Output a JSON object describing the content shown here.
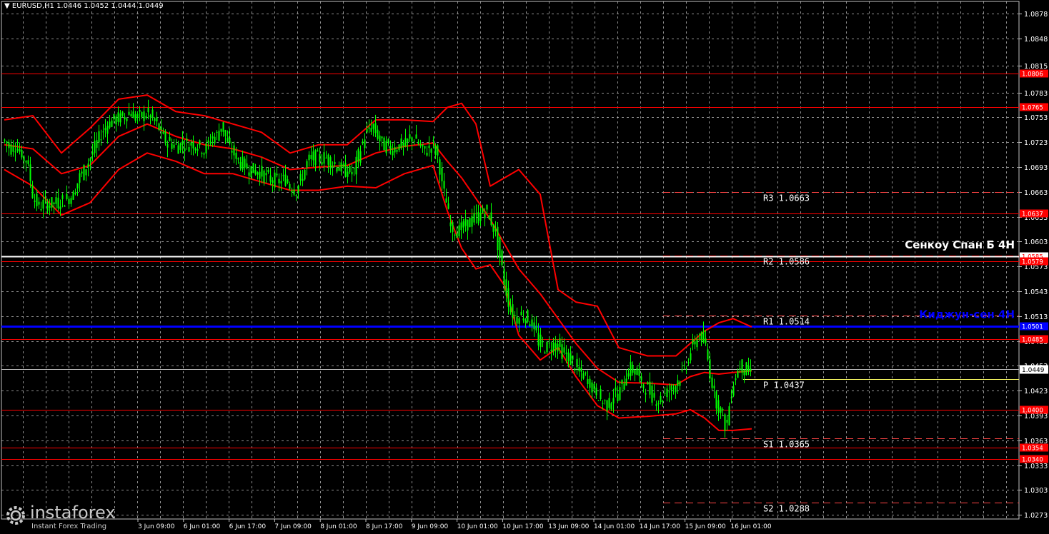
{
  "header": {
    "symbol_line": "EURUSD,H1  1.0446 1.0452 1.0444 1.0449"
  },
  "logo": {
    "brand": "instaforex",
    "tagline": "Instant Forex Trading"
  },
  "colors": {
    "background": "#000000",
    "grid": "#c0c0c0",
    "candles": "#00ff00",
    "bollinger": "#ff0000",
    "levels": "#ff0000",
    "kijun": "#0000ff",
    "senkou": "#ffffff",
    "pivot": "#ffff66",
    "pivot_sr": "#ff4444"
  },
  "chart_data": {
    "type": "candlestick",
    "symbol": "EURUSD",
    "timeframe": "H1",
    "ylim": [
      1.0268,
      1.0893
    ],
    "y_ticks": [
      "1.0878",
      "1.0848",
      "1.0815",
      "1.0783",
      "1.0753",
      "1.0723",
      "1.0693",
      "1.0663",
      "1.0633",
      "1.0603",
      "1.0573",
      "1.0543",
      "1.0513",
      "1.0483",
      "1.0453",
      "1.0423",
      "1.0393",
      "1.0363",
      "1.0333",
      "1.0303",
      "1.0273"
    ],
    "x_ticks": [
      "3 Jun 09:00",
      "6 Jun 01:00",
      "6 Jun 17:00",
      "7 Jun 09:00",
      "8 Jun 01:00",
      "8 Jun 17:00",
      "9 Jun 09:00",
      "10 Jun 01:00",
      "10 Jun 17:00",
      "13 Jun 09:00",
      "14 Jun 01:00",
      "14 Jun 17:00",
      "15 Jun 09:00",
      "16 Jun 01:00"
    ],
    "last_price": {
      "value": 1.0449,
      "label": "1.0449"
    },
    "horizontal_levels": [
      {
        "value": 1.0806,
        "label": "1.0806",
        "kind": "level"
      },
      {
        "value": 1.0765,
        "label": "1.0765",
        "kind": "level"
      },
      {
        "value": 1.0637,
        "label": "1.0637",
        "kind": "level"
      },
      {
        "value": 1.0585,
        "label": "1.0585",
        "kind": "senkou"
      },
      {
        "value": 1.0579,
        "label": "1.0579",
        "kind": "level"
      },
      {
        "value": 1.0501,
        "label": "1.0501",
        "kind": "kijun"
      },
      {
        "value": 1.0485,
        "label": "1.0485",
        "kind": "level"
      },
      {
        "value": 1.04,
        "label": "1.0400",
        "kind": "level"
      },
      {
        "value": 1.0354,
        "label": "1.0354",
        "kind": "level"
      },
      {
        "value": 1.034,
        "label": "1.0340",
        "kind": "level"
      }
    ],
    "pivots": [
      {
        "name": "R3",
        "value": 1.0663,
        "label": "R3  1.0663"
      },
      {
        "name": "R2",
        "value": 1.0586,
        "label": "R2  1.0586"
      },
      {
        "name": "R1",
        "value": 1.0514,
        "label": "R1  1.0514"
      },
      {
        "name": "P",
        "value": 1.0437,
        "label": "P  1.0437"
      },
      {
        "name": "S1",
        "value": 1.0365,
        "label": "S1  1.0365"
      },
      {
        "name": "S2",
        "value": 1.0288,
        "label": "S2  1.0288"
      }
    ],
    "annotations": [
      {
        "text": "Сенкоу Спан Б 4H",
        "value": 1.06,
        "color": "#ffffff"
      },
      {
        "text": "Киджун-сен 4H",
        "value": 1.0514,
        "color": "#0000ff"
      }
    ],
    "price_path": [
      [
        0,
        1.0725
      ],
      [
        8,
        1.0715
      ],
      [
        16,
        1.072
      ],
      [
        24,
        1.0705
      ],
      [
        32,
        1.07
      ],
      [
        40,
        1.0655
      ],
      [
        48,
        1.0645
      ],
      [
        56,
        1.065
      ],
      [
        64,
        1.0648
      ],
      [
        72,
        1.065
      ],
      [
        80,
        1.0652
      ],
      [
        88,
        1.0655
      ],
      [
        96,
        1.066
      ],
      [
        104,
        1.068
      ],
      [
        112,
        1.069
      ],
      [
        120,
        1.0705
      ],
      [
        128,
        1.072
      ],
      [
        136,
        1.0735
      ],
      [
        144,
        1.0745
      ],
      [
        152,
        1.075
      ],
      [
        160,
        1.0752
      ],
      [
        168,
        1.0755
      ],
      [
        176,
        1.076
      ],
      [
        184,
        1.0752
      ],
      [
        192,
        1.0755
      ],
      [
        200,
        1.0758
      ],
      [
        208,
        1.075
      ],
      [
        216,
        1.074
      ],
      [
        224,
        1.0725
      ],
      [
        232,
        1.0722
      ],
      [
        240,
        1.0718
      ],
      [
        248,
        1.0722
      ],
      [
        256,
        1.072
      ],
      [
        264,
        1.0722
      ],
      [
        272,
        1.0718
      ],
      [
        280,
        1.0712
      ],
      [
        288,
        1.0728
      ],
      [
        296,
        1.073
      ],
      [
        304,
        1.0745
      ],
      [
        312,
        1.072
      ],
      [
        320,
        1.071
      ],
      [
        328,
        1.07
      ],
      [
        336,
        1.0695
      ],
      [
        344,
        1.069
      ],
      [
        352,
        1.0688
      ],
      [
        360,
        1.0685
      ],
      [
        368,
        1.068
      ],
      [
        376,
        1.0678
      ],
      [
        384,
        1.0675
      ],
      [
        392,
        1.068
      ],
      [
        400,
        1.067
      ],
      [
        408,
        1.0665
      ],
      [
        416,
        1.068
      ],
      [
        424,
        1.07
      ],
      [
        432,
        1.0705
      ],
      [
        440,
        1.0703
      ],
      [
        448,
        1.0705
      ],
      [
        456,
        1.07
      ],
      [
        464,
        1.0695
      ],
      [
        472,
        1.069
      ],
      [
        480,
        1.0688
      ],
      [
        488,
        1.0685
      ],
      [
        496,
        1.071
      ],
      [
        504,
        1.073
      ],
      [
        512,
        1.0742
      ],
      [
        520,
        1.0735
      ],
      [
        528,
        1.072
      ],
      [
        536,
        1.0718
      ],
      [
        544,
        1.0715
      ],
      [
        552,
        1.072
      ],
      [
        560,
        1.0718
      ],
      [
        568,
        1.073
      ],
      [
        576,
        1.0725
      ],
      [
        584,
        1.0712
      ],
      [
        592,
        1.0715
      ],
      [
        600,
        1.072
      ],
      [
        608,
        1.07
      ],
      [
        612,
        1.067
      ],
      [
        618,
        1.065
      ],
      [
        624,
        1.062
      ],
      [
        632,
        1.0615
      ],
      [
        640,
        1.062
      ],
      [
        648,
        1.0625
      ],
      [
        656,
        1.063
      ],
      [
        664,
        1.0635
      ],
      [
        672,
        1.064
      ],
      [
        680,
        1.063
      ],
      [
        688,
        1.061
      ],
      [
        694,
        1.058
      ],
      [
        700,
        1.055
      ],
      [
        708,
        1.052
      ],
      [
        716,
        1.051
      ],
      [
        724,
        1.0515
      ],
      [
        732,
        1.051
      ],
      [
        740,
        1.05
      ],
      [
        748,
        1.048
      ],
      [
        756,
        1.0475
      ],
      [
        764,
        1.0478
      ],
      [
        772,
        1.048
      ],
      [
        780,
        1.047
      ],
      [
        788,
        1.0465
      ],
      [
        796,
        1.0455
      ],
      [
        804,
        1.0445
      ],
      [
        812,
        1.044
      ],
      [
        820,
        1.043
      ],
      [
        828,
        1.042
      ],
      [
        836,
        1.041
      ],
      [
        844,
        1.0405
      ],
      [
        852,
        1.0418
      ],
      [
        860,
        1.042
      ],
      [
        868,
        1.044
      ],
      [
        876,
        1.045
      ],
      [
        884,
        1.0445
      ],
      [
        892,
        1.043
      ],
      [
        900,
        1.0425
      ],
      [
        908,
        1.0415
      ],
      [
        916,
        1.041
      ],
      [
        924,
        1.042
      ],
      [
        932,
        1.0425
      ],
      [
        940,
        1.0432
      ],
      [
        948,
        1.0445
      ],
      [
        956,
        1.046
      ],
      [
        964,
        1.048
      ],
      [
        972,
        1.049
      ],
      [
        980,
        1.048
      ],
      [
        988,
        1.044
      ],
      [
        996,
        1.041
      ],
      [
        1004,
        1.0395
      ],
      [
        1010,
        1.0375
      ],
      [
        1016,
        1.042
      ],
      [
        1022,
        1.044
      ],
      [
        1030,
        1.0455
      ],
      [
        1038,
        1.0445
      ],
      [
        1046,
        1.0449
      ]
    ],
    "bollinger": {
      "upper": [
        [
          0,
          1.075
        ],
        [
          40,
          1.0755
        ],
        [
          80,
          1.071
        ],
        [
          120,
          1.074
        ],
        [
          160,
          1.0775
        ],
        [
          200,
          1.078
        ],
        [
          240,
          1.076
        ],
        [
          280,
          1.0755
        ],
        [
          320,
          1.0745
        ],
        [
          360,
          1.0735
        ],
        [
          400,
          1.071
        ],
        [
          440,
          1.072
        ],
        [
          480,
          1.072
        ],
        [
          520,
          1.075
        ],
        [
          560,
          1.075
        ],
        [
          600,
          1.0748
        ],
        [
          620,
          1.0765
        ],
        [
          640,
          1.077
        ],
        [
          660,
          1.0745
        ],
        [
          680,
          1.067
        ],
        [
          700,
          1.068
        ],
        [
          720,
          1.069
        ],
        [
          750,
          1.066
        ],
        [
          775,
          1.0545
        ],
        [
          800,
          1.053
        ],
        [
          830,
          1.0525
        ],
        [
          860,
          1.0475
        ],
        [
          900,
          1.0465
        ],
        [
          940,
          1.0465
        ],
        [
          960,
          1.048
        ],
        [
          980,
          1.0495
        ],
        [
          1000,
          1.0505
        ],
        [
          1020,
          1.051
        ],
        [
          1046,
          1.05
        ]
      ],
      "middle": [
        [
          0,
          1.072
        ],
        [
          40,
          1.0715
        ],
        [
          80,
          1.0685
        ],
        [
          120,
          1.0695
        ],
        [
          160,
          1.073
        ],
        [
          200,
          1.0745
        ],
        [
          240,
          1.073
        ],
        [
          280,
          1.072
        ],
        [
          320,
          1.0715
        ],
        [
          360,
          1.0705
        ],
        [
          400,
          1.069
        ],
        [
          440,
          1.0693
        ],
        [
          480,
          1.0695
        ],
        [
          520,
          1.071
        ],
        [
          560,
          1.0718
        ],
        [
          600,
          1.0722
        ],
        [
          620,
          1.07
        ],
        [
          640,
          1.068
        ],
        [
          660,
          1.0655
        ],
        [
          680,
          1.063
        ],
        [
          700,
          1.06
        ],
        [
          720,
          1.057
        ],
        [
          750,
          1.054
        ],
        [
          775,
          1.051
        ],
        [
          800,
          1.048
        ],
        [
          830,
          1.045
        ],
        [
          860,
          1.0433
        ],
        [
          900,
          1.0432
        ],
        [
          940,
          1.043
        ],
        [
          960,
          1.044
        ],
        [
          980,
          1.0445
        ],
        [
          1000,
          1.0443
        ],
        [
          1020,
          1.0445
        ],
        [
          1046,
          1.0447
        ]
      ],
      "lower": [
        [
          0,
          1.069
        ],
        [
          40,
          1.067
        ],
        [
          80,
          1.0635
        ],
        [
          120,
          1.065
        ],
        [
          160,
          1.069
        ],
        [
          200,
          1.071
        ],
        [
          240,
          1.07
        ],
        [
          280,
          1.0685
        ],
        [
          320,
          1.0685
        ],
        [
          360,
          1.0675
        ],
        [
          400,
          1.0665
        ],
        [
          440,
          1.0665
        ],
        [
          480,
          1.067
        ],
        [
          520,
          1.0668
        ],
        [
          560,
          1.0685
        ],
        [
          600,
          1.0695
        ],
        [
          620,
          1.064
        ],
        [
          640,
          1.0595
        ],
        [
          660,
          1.057
        ],
        [
          680,
          1.0575
        ],
        [
          700,
          1.055
        ],
        [
          720,
          1.049
        ],
        [
          750,
          1.046
        ],
        [
          775,
          1.0475
        ],
        [
          800,
          1.044
        ],
        [
          830,
          1.0405
        ],
        [
          860,
          1.039
        ],
        [
          900,
          1.0392
        ],
        [
          940,
          1.0395
        ],
        [
          960,
          1.04
        ],
        [
          980,
          1.039
        ],
        [
          1000,
          1.0375
        ],
        [
          1020,
          1.0375
        ],
        [
          1046,
          1.0377
        ]
      ]
    }
  }
}
